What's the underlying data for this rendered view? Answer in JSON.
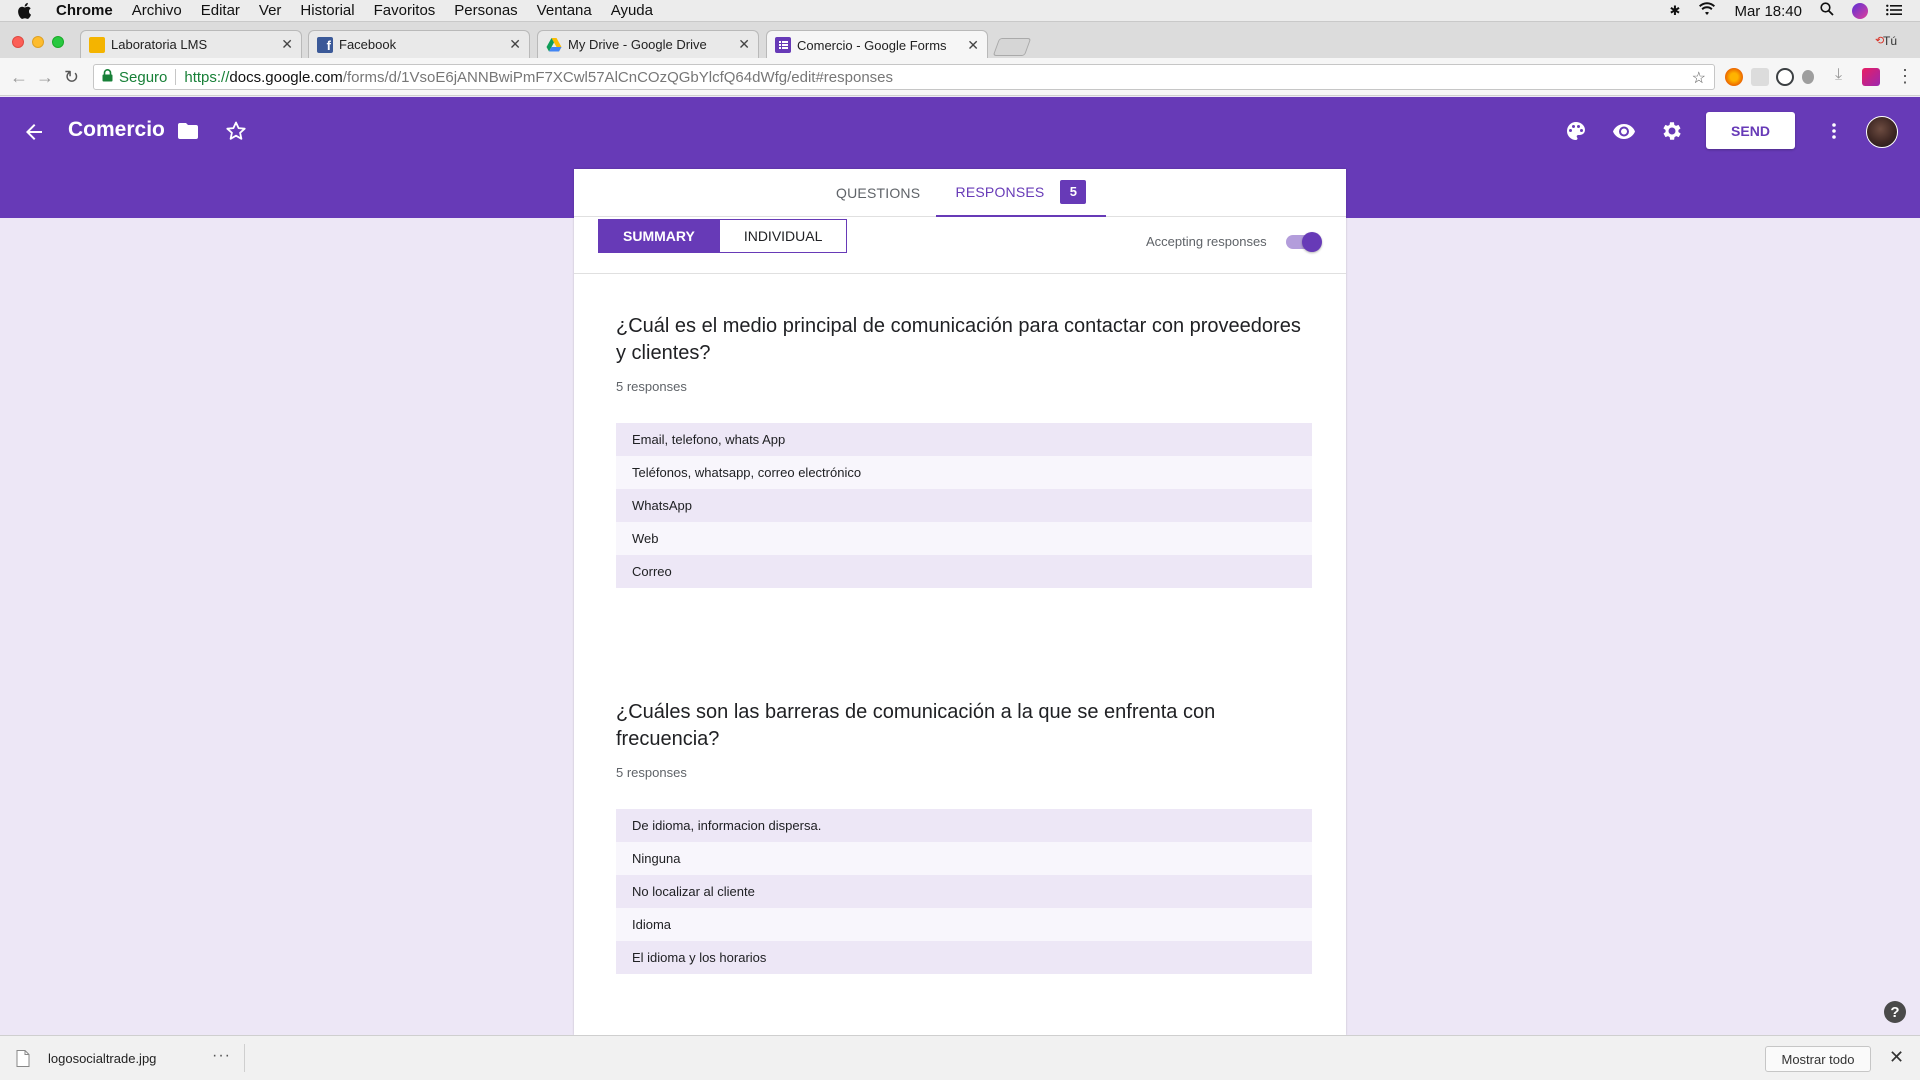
{
  "menubar": {
    "app": "Chrome",
    "items": [
      "Archivo",
      "Editar",
      "Ver",
      "Historial",
      "Favoritos",
      "Personas",
      "Ventana",
      "Ayuda"
    ],
    "clock": "Mar 18:40",
    "user": "Tú"
  },
  "browser_tabs": [
    {
      "title": "Laboratoria LMS",
      "favicon": "laboratoria-icon",
      "color": "#f4b400"
    },
    {
      "title": "Facebook",
      "favicon": "facebook-icon",
      "color": "#3b5998"
    },
    {
      "title": "My Drive - Google Drive",
      "favicon": "drive-icon",
      "color": "#0f9d58"
    },
    {
      "title": "Comercio - Google Forms",
      "favicon": "forms-icon",
      "color": "#673ab7"
    }
  ],
  "omnibox": {
    "secure_label": "Seguro",
    "scheme": "https://",
    "host": "docs.google.com",
    "path": "/forms/d/1VsoE6jANNBwiPmF7XCwl57AlCnCOzQGbYlcfQ64dWfg/edit#responses"
  },
  "form_header": {
    "title": "Comercio",
    "send_label": "SEND",
    "accent": "#673ab7"
  },
  "form_tabs": {
    "questions_label": "QUESTIONS",
    "responses_label": "RESPONSES",
    "responses_count": "5"
  },
  "view_toggle": {
    "summary_label": "SUMMARY",
    "individual_label": "INDIVIDUAL"
  },
  "accepting": {
    "label": "Accepting responses",
    "enabled": true
  },
  "questions": [
    {
      "title": "¿Cuál es el medio principal de comunicación para contactar con proveedores y clientes?",
      "count": "5 responses",
      "answers": [
        "Email, telefono, whats App",
        "Teléfonos, whatsapp, correo electrónico",
        "WhatsApp",
        "Web",
        "Correo"
      ]
    },
    {
      "title": "¿Cuáles son las barreras de comunicación a la que se enfrenta con frecuencia?",
      "count": "5 responses",
      "answers": [
        "De idioma, informacion dispersa.",
        "Ninguna",
        "No localizar al cliente",
        "Idioma",
        "El idioma y los horarios"
      ]
    }
  ],
  "download_bar": {
    "filename": "logosocialtrade.jpg",
    "more": "···",
    "show_all": "Mostrar todo"
  },
  "help": "?"
}
